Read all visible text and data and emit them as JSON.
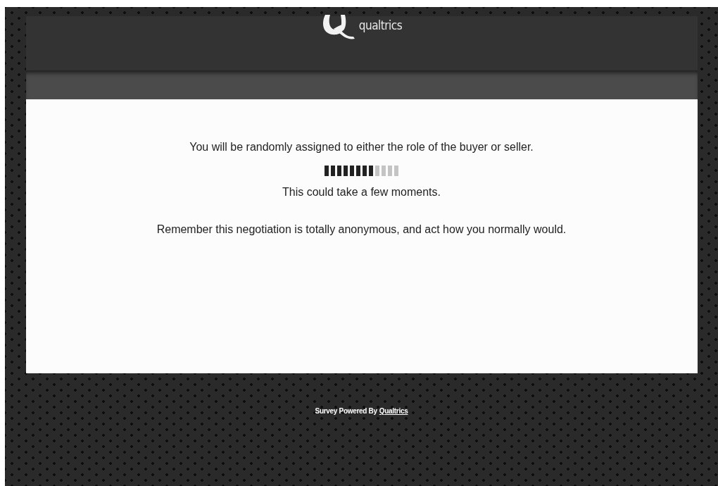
{
  "header": {
    "logo_text": "qualtrics"
  },
  "content": {
    "lines": [
      "You will be randomly assigned to either the role of the buyer or seller.",
      "This could take a few moments.",
      "Remember this negotiation is totally anonymous, and act how you normally would."
    ],
    "loader": {
      "level": 0.667
    }
  },
  "footer": {
    "text": "Survey Powered By",
    "link": "Qualtrics"
  }
}
